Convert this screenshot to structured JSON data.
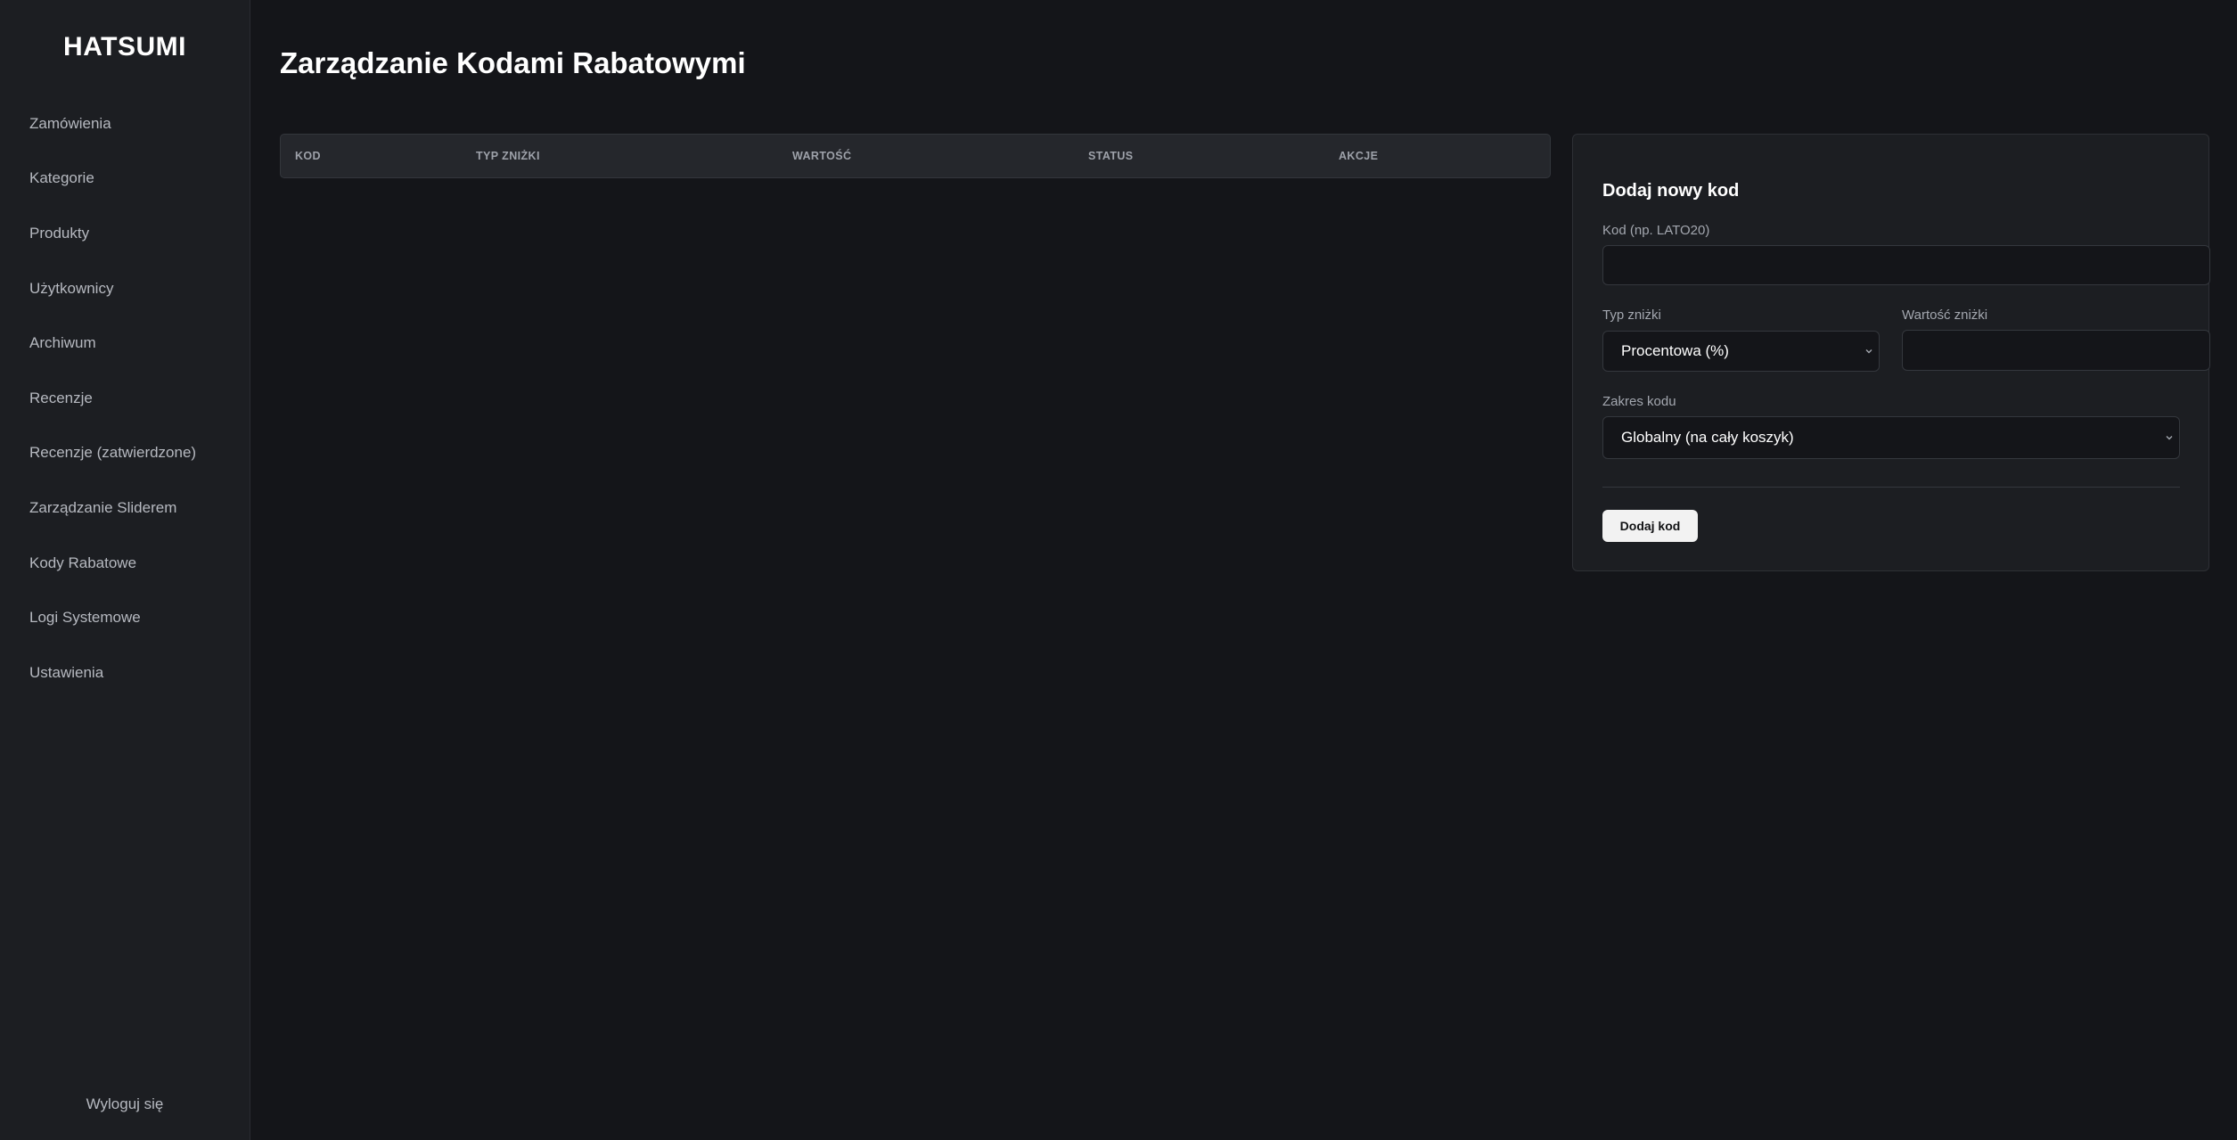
{
  "brand": "HATSUMI",
  "sidebar": {
    "items": [
      {
        "label": "Zamówienia"
      },
      {
        "label": "Kategorie"
      },
      {
        "label": "Produkty"
      },
      {
        "label": "Użytkownicy"
      },
      {
        "label": "Archiwum"
      },
      {
        "label": "Recenzje"
      },
      {
        "label": "Recenzje (zatwierdzone)"
      },
      {
        "label": "Zarządzanie Sliderem"
      },
      {
        "label": "Kody Rabatowe"
      },
      {
        "label": "Logi Systemowe"
      },
      {
        "label": "Ustawienia"
      }
    ],
    "logout": "Wyloguj się"
  },
  "main": {
    "title": "Zarządzanie Kodami Rabatowymi",
    "table": {
      "columns": [
        "KOD",
        "TYP ZNIŻKI",
        "WARTOŚĆ",
        "STATUS",
        "AKCJE"
      ],
      "rows": []
    }
  },
  "form": {
    "title": "Dodaj nowy kod",
    "code_label": "Kod (np. LATO20)",
    "code_value": "",
    "type_label": "Typ zniżki",
    "type_selected": "Procentowa (%)",
    "value_label": "Wartość zniżki",
    "value_value": "",
    "scope_label": "Zakres kodu",
    "scope_selected": "Globalny (na cały koszyk)",
    "submit_label": "Dodaj kod"
  },
  "colors": {
    "background": "#141519",
    "sidebar": "#1c1e22",
    "button": "#f2f2f2"
  }
}
